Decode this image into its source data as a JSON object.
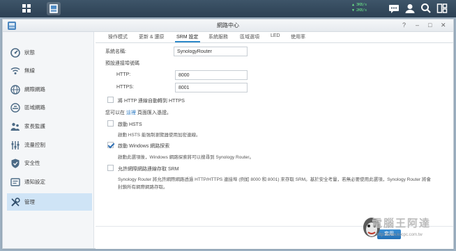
{
  "taskbar": {
    "net_up": "3KB/s",
    "net_down": "2KB/s",
    "icons": [
      "grid-icon",
      "network-center-app-icon",
      "chat-icon",
      "user-icon",
      "search-icon",
      "widgets-icon"
    ]
  },
  "window": {
    "title": "網路中心",
    "controls": [
      "?",
      "–",
      "□",
      "✕"
    ]
  },
  "sidebar": {
    "items": [
      {
        "label": "狀態",
        "icon": "status-icon"
      },
      {
        "label": "無線",
        "icon": "wifi-icon"
      },
      {
        "label": "網際網路",
        "icon": "internet-icon"
      },
      {
        "label": "區域網路",
        "icon": "lan-icon"
      },
      {
        "label": "家長監護",
        "icon": "parental-icon"
      },
      {
        "label": "流量控制",
        "icon": "traffic-icon"
      },
      {
        "label": "安全性",
        "icon": "security-icon"
      },
      {
        "label": "通知設定",
        "icon": "notification-icon"
      },
      {
        "label": "管理",
        "icon": "tools-icon",
        "active": true
      }
    ]
  },
  "tabs": [
    "操作模式",
    "更新 & 還原",
    "SRM 設定",
    "系統服務",
    "區域選項",
    "LED",
    "使用率"
  ],
  "active_tab": "SRM 設定",
  "form": {
    "system_name_label": "系統名稱:",
    "system_name_value": "SynologyRouter",
    "default_ports_label": "預設連接埠號碼",
    "http_label": "HTTP:",
    "http_value": "8000",
    "https_label": "HTTPS:",
    "https_value": "8001",
    "redirect_https_label": "將 HTTP 連線自動轉到 HTTPS",
    "customize_prefix": "您可以在",
    "customize_link": "這裡",
    "customize_suffix": "頁面匯入憑證。",
    "hsts_label": "啟動 HSTS",
    "hsts_desc": "啟動 HSTS 能強制瀏覽器使用加密連線。",
    "windows_discovery_label": "啟動 Windows 網路探索",
    "windows_discovery_desc": "啟動此選項後，Windows 網路探索將可以搜尋到 Synology Router。",
    "external_access_label": "允許網際網路連線存取 SRM",
    "external_access_desc_1": "Synology Router 將允許網際網路透過 HTTP/HTTPS 連接埠 (例如 8000 和 8001) 來存取 SRM。基於安全考量，若無必要使用此選項，Synology Router 將會",
    "external_access_desc_2": "封鎖所有網際網路存取。"
  },
  "footer": {
    "apply_label": "套用"
  },
  "watermark": {
    "text": "電腦王阿達",
    "url": "http://www.kocpc.com.tw"
  },
  "colors": {
    "accent": "#2d89c9",
    "sidebar_active": "#cfe4f6",
    "taskbar": "#2c4053"
  }
}
